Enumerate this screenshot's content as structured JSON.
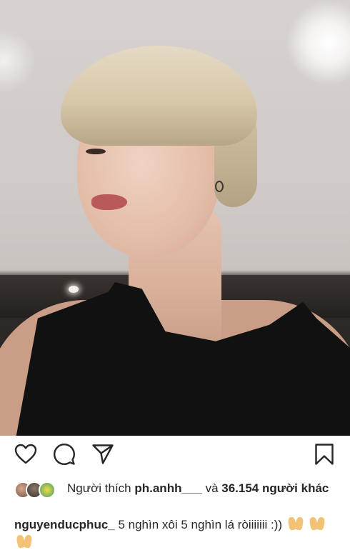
{
  "post": {
    "photo_icon": "photo-post",
    "actions": {
      "like_icon": "heart-outline",
      "comment_icon": "speech-bubble",
      "share_icon": "paper-plane",
      "save_icon": "bookmark"
    },
    "likes": {
      "prefix": "Người thích",
      "user": "ph.anhh___",
      "connector": "và",
      "count": "36.154",
      "suffix": "người khác"
    },
    "caption": {
      "username": "nguyenducphuc_",
      "text": "5 nghìn xôi 5 nghìn lá ròiiiiiii :))",
      "emoji": "folded-hands"
    }
  }
}
